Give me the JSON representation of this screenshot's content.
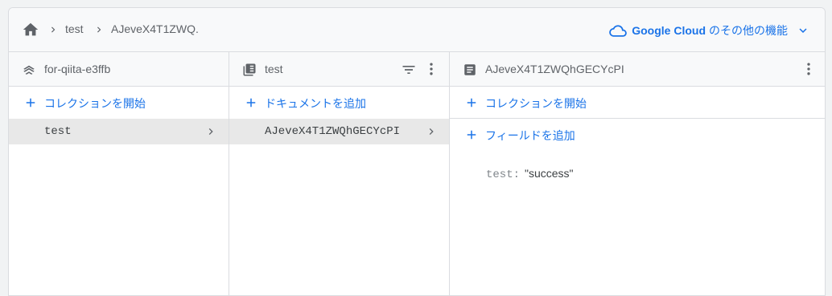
{
  "breadcrumb": {
    "items": [
      "test",
      "AJeveX4T1ZWQ."
    ]
  },
  "header": {
    "google_cloud_brand": "Google Cloud",
    "google_cloud_suffix": "のその他の機能"
  },
  "columns": {
    "project": {
      "title": "for-qiita-e3ffb",
      "add_label": "コレクションを開始",
      "items": [
        "test"
      ]
    },
    "collection": {
      "title": "test",
      "add_label": "ドキュメントを追加",
      "items": [
        "AJeveX4T1ZWQhGECYcPI"
      ]
    },
    "document": {
      "title": "AJeveX4T1ZWQhGECYcPI",
      "add_collection_label": "コレクションを開始",
      "add_field_label": "フィールドを追加",
      "fields": [
        {
          "key": "test:",
          "value": "\"success\""
        }
      ]
    }
  },
  "colors": {
    "accent": "#1a73e8",
    "selected_bg": "#e8e8e8",
    "border": "#dadce0"
  },
  "icons": {
    "home": "home-icon",
    "breadcrumb_sep": "chevron-right-icon",
    "cloud": "cloud-icon",
    "expand": "chevron-down-icon",
    "project": "firestore-stack-icon",
    "collection": "collection-icon",
    "document": "document-icon",
    "filter": "filter-icon",
    "menu": "more-vert-icon",
    "add": "plus-icon"
  }
}
